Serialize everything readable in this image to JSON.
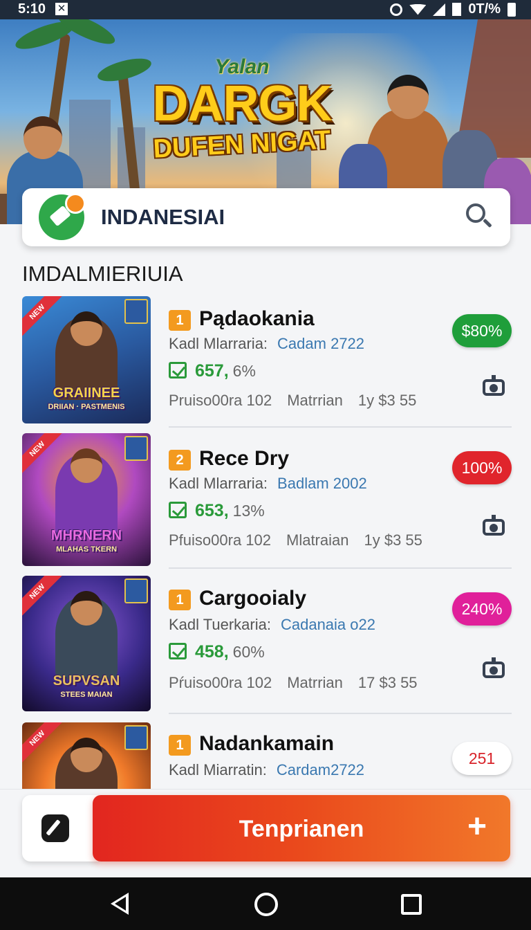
{
  "status_bar": {
    "time": "5:10",
    "notification_icon": "x-box-icon",
    "battery_text": "0T/%"
  },
  "hero": {
    "logo_top": "Yalan",
    "logo_main": "DARGK",
    "logo_bottom": "DUFEN NIGAT"
  },
  "search": {
    "brand_icon": "chat-pen-logo-icon",
    "title": "INDANESIAI",
    "icon": "search-icon"
  },
  "section_title": "IMDALMIERIUIA",
  "games": [
    {
      "rank": "1",
      "rank_color": "#f39a1f",
      "name": "Pądaokania",
      "meta_label": "Kadl Mlarraria:",
      "meta_value": "Cadam 2722",
      "score": "657,",
      "score_pct": "6%",
      "info_left": "Pruiso00ra 102",
      "info_mid": "Matrrian",
      "info_right": "1y $3 55",
      "pill": "$80%",
      "pill_color": "#1f9e3a",
      "thumb_title": "GRAIINEE",
      "thumb_sub": "DRIIAN · PASTMENIS"
    },
    {
      "rank": "2",
      "rank_color": "#f39a1f",
      "name": "Rece Dry",
      "meta_label": "Kadl Mlarraria:",
      "meta_value": "Badlam 2002",
      "score": "653,",
      "score_pct": "13%",
      "info_left": "Pfuiso00ra 102",
      "info_mid": "Mlatraian",
      "info_right": "1y $3 55",
      "pill": "100%",
      "pill_color": "#e0252c",
      "thumb_title": "MHRNERN",
      "thumb_sub": "MLAHAS TKERN"
    },
    {
      "rank": "1",
      "rank_color": "#f39a1f",
      "name": "Cargooialy",
      "meta_label": "Kadl Tuerkaria:",
      "meta_value": "Cadanaia o22",
      "score": "458,",
      "score_pct": "60%",
      "info_left": "Pŕuiso00ra 102",
      "info_mid": "Matrrian",
      "info_right": "17 $3 55",
      "pill": "240%",
      "pill_color": "#e0209a",
      "thumb_title": "SUPVSAN",
      "thumb_sub": "STEES MAIAN"
    },
    {
      "rank": "1",
      "rank_color": "#f39a1f",
      "name": "Nadankamain",
      "meta_label": "Kadl Miarratin:",
      "meta_value": "Cardam2722",
      "score": "",
      "score_pct": "",
      "info_left": "",
      "info_mid": "",
      "info_right": "",
      "pill": "251",
      "pill_color": "#ffffff",
      "thumb_title": "",
      "thumb_sub": ""
    }
  ],
  "action_bar": {
    "edit_icon": "edit-pen-icon",
    "primary_label": "Tenprianen",
    "plus": "+"
  },
  "nav": {
    "back": "back-icon",
    "home": "home-icon",
    "recent": "recents-icon"
  }
}
